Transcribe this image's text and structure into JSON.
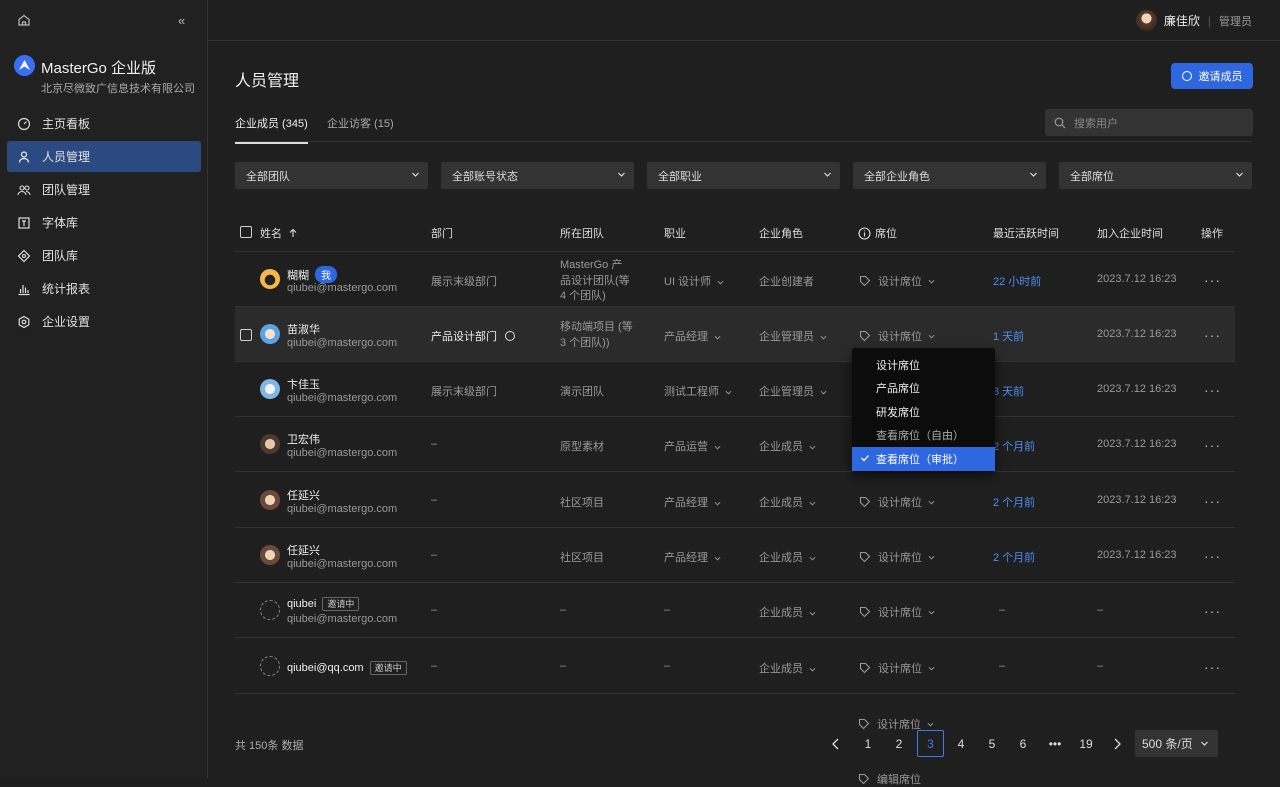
{
  "sidebar": {
    "brand": "MasterGo 企业版",
    "org": "北京尽微致广信息技术有限公司",
    "items": [
      {
        "label": "主页看板",
        "icon": "dashboard-icon"
      },
      {
        "label": "人员管理",
        "icon": "user-icon"
      },
      {
        "label": "团队管理",
        "icon": "team-icon"
      },
      {
        "label": "字体库",
        "icon": "font-library-icon"
      },
      {
        "label": "团队库",
        "icon": "team-library-icon"
      },
      {
        "label": "统计报表",
        "icon": "chart-icon"
      },
      {
        "label": "企业设置",
        "icon": "settings-icon"
      }
    ]
  },
  "header": {
    "user_name": "廉佳欣",
    "user_role": "管理员"
  },
  "page": {
    "title": "人员管理",
    "invite_label": "邀请成员"
  },
  "tabs": [
    {
      "label": "企业成员 (345)"
    },
    {
      "label": "企业访客 (15)"
    }
  ],
  "search": {
    "placeholder": "搜索用户"
  },
  "filters": [
    "全部团队",
    "全部账号状态",
    "全部职业",
    "全部企业角色",
    "全部席位"
  ],
  "table": {
    "headers": {
      "name": "姓名",
      "dept": "部门",
      "team": "所在团队",
      "job": "职业",
      "role": "企业角色",
      "seat": "席位",
      "last_active": "最近活跃时间",
      "joined": "加入企业时间",
      "action": "操作"
    },
    "rows": [
      {
        "name": "糊糊",
        "email": "qiubei@mastergo.com",
        "dept": "展示末级部门",
        "team1": "MasterGo 产",
        "team2": "品设计团队(等",
        "team3": "4 个团队)",
        "job": "UI 设计师",
        "role": "企业创建者",
        "seat": "设计席位",
        "last_active": "22 小时前",
        "joined": "2023.7.12 16:23",
        "me": "我"
      },
      {
        "name": "苗淑华",
        "email": "qiubei@mastergo.com",
        "dept": "产品设计部门",
        "team1": "移动端项目 (等",
        "team2": " 3 个团队))",
        "job": "产品经理",
        "role": "企业管理员",
        "seat": "设计席位",
        "last_active": "1 天前",
        "joined": "2023.7.12 16:23"
      },
      {
        "name": "卞佳玉",
        "email": "qiubei@mastergo.com",
        "dept": "展示末级部门",
        "team1": "演示团队",
        "job": "测试工程师",
        "role": "企业管理员",
        "last_active": "3 天前",
        "joined": "2023.7.12 16:23"
      },
      {
        "name": "卫宏伟",
        "email": "qiubei@mastergo.com",
        "dept": "–",
        "team1": "原型素材",
        "job": "产品运营",
        "role": "企业成员",
        "last_active": "2 个月前",
        "joined": "2023.7.12 16:23"
      },
      {
        "name": "任延兴",
        "email": "qiubei@mastergo.com",
        "dept": "–",
        "team1": "社区项目",
        "job": "产品经理",
        "role": "企业成员",
        "seat": "设计席位",
        "last_active": "2 个月前",
        "joined": "2023.7.12 16:23"
      },
      {
        "name": "任延兴",
        "email": "qiubei@mastergo.com",
        "dept": "–",
        "team1": "社区项目",
        "job": "产品经理",
        "role": "企业成员",
        "seat": "设计席位",
        "last_active": "2 个月前",
        "joined": "2023.7.12 16:23"
      },
      {
        "name": "qiubei",
        "email": "qiubei@mastergo.com",
        "dept": "–",
        "team1": "–",
        "job": "–",
        "role": "企业成员",
        "seat": "设计席位",
        "last_active": "–",
        "joined": "–",
        "invite": "邀请中"
      },
      {
        "name": "qiubei@qq.com",
        "dept": "–",
        "team1": "–",
        "job": "–",
        "role": "企业成员",
        "seat": "设计席位",
        "last_active": "–",
        "joined": "–",
        "invite": "邀请中"
      }
    ]
  },
  "seat_menu": {
    "options": [
      "设计席位",
      "产品席位",
      "研发席位",
      "查看席位（自由）",
      "查看席位（审批）"
    ],
    "selected": "查看席位（审批）"
  },
  "ghost_rows": [
    "设计席位",
    "编辑席位"
  ],
  "footer": {
    "total": "共 150条 数据",
    "pages": [
      "1",
      "2",
      "3",
      "4",
      "5",
      "6",
      "•••",
      "19"
    ],
    "current": "3",
    "page_size": "500 条/页"
  },
  "colors": {
    "accent": "#2e67e0",
    "active_nav": "#2c4a82",
    "link": "#4b8ef5"
  }
}
